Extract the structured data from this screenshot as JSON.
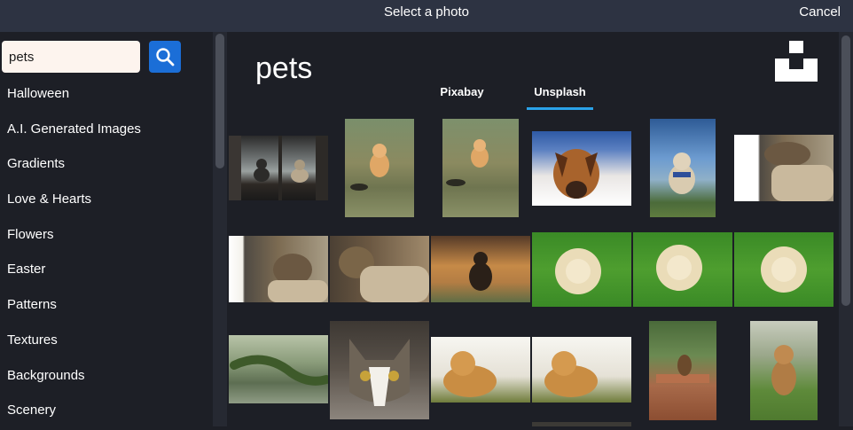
{
  "dialog": {
    "title": "Select a photo",
    "cancel_label": "Cancel"
  },
  "search": {
    "value": "pets",
    "button_icon": "search-icon"
  },
  "categories": [
    "Halloween",
    "A.I. Generated Images",
    "Gradients",
    "Love & Hearts",
    "Flowers",
    "Easter",
    "Patterns",
    "Textures",
    "Backgrounds",
    "Scenery"
  ],
  "results": {
    "heading": "pets",
    "provider_logo": "unsplash-logo-icon",
    "tabs": [
      {
        "label": "Pixabay",
        "active": false
      },
      {
        "label": "Unsplash",
        "active": true
      }
    ],
    "accent_color": "#2aa2e8"
  },
  "photos": [
    {
      "name": "cats-at-window-photo"
    },
    {
      "name": "corgi-running-photo"
    },
    {
      "name": "corgi-running-2-photo"
    },
    {
      "name": "dog-in-snow-photo"
    },
    {
      "name": "cat-with-harness-photo"
    },
    {
      "name": "cat-on-cat-tree-photo"
    },
    {
      "name": "cat-on-cat-tree-2-photo"
    },
    {
      "name": "cat-on-cat-tree-3-photo"
    },
    {
      "name": "rottweiler-in-field-photo"
    },
    {
      "name": "pomeranian-on-grass-photo"
    },
    {
      "name": "pomeranian-on-grass-2-photo"
    },
    {
      "name": "pomeranian-on-grass-3-photo"
    },
    {
      "name": "lizard-photo"
    },
    {
      "name": "tabby-cat-closeup-photo"
    },
    {
      "name": "golden-puppy-photo"
    },
    {
      "name": "golden-puppy-2-photo"
    },
    {
      "name": "dog-at-picnic-table-photo"
    },
    {
      "name": "puppy-on-lawn-photo"
    }
  ]
}
